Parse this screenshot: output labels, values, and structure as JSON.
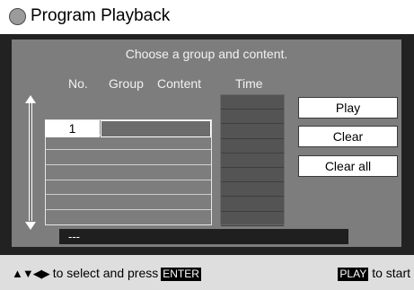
{
  "title": "Program Playback",
  "instruction": "Choose a group and content.",
  "columns": {
    "no": "No.",
    "group": "Group",
    "content": "Content",
    "time": "Time"
  },
  "selected_row": {
    "no": "1"
  },
  "buttons": {
    "play": "Play",
    "clear": "Clear",
    "clear_all": "Clear all"
  },
  "status_text": "---",
  "footer": {
    "arrows": "▲▼◀▶",
    "select_text": "to select and press",
    "enter_key": "ENTER",
    "play_key": "PLAY",
    "start_text": "to start"
  },
  "colors": {
    "panel": "#7d7d7d",
    "frame": "#222222",
    "footer": "#dedede"
  }
}
